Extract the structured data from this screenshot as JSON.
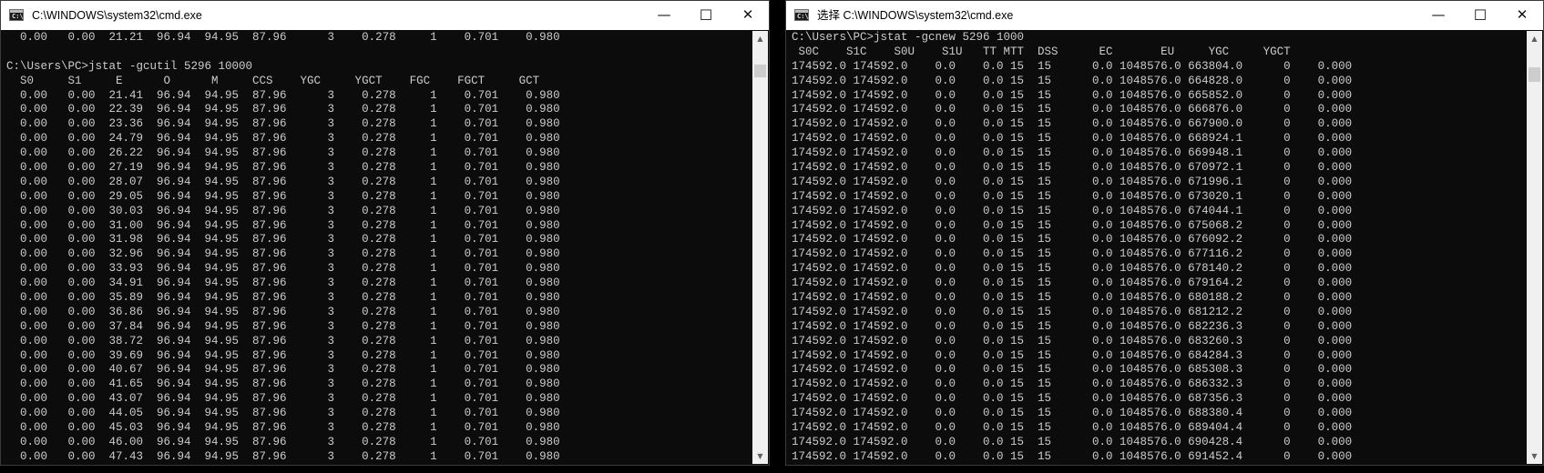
{
  "left_window": {
    "icon_label": "C:\\",
    "title": "C:\\WINDOWS\\system32\\cmd.exe",
    "controls": {
      "minimize": "—",
      "maximize": "☐",
      "close": "✕"
    },
    "lines": [
      "  0.00   0.00  21.21  96.94  94.95  87.96      3    0.278     1    0.701    0.980",
      "",
      "C:\\Users\\PC>jstat -gcutil 5296 10000",
      "  S0     S1     E      O      M     CCS    YGC     YGCT    FGC    FGCT     GCT",
      "  0.00   0.00  21.41  96.94  94.95  87.96      3    0.278     1    0.701    0.980",
      "  0.00   0.00  22.39  96.94  94.95  87.96      3    0.278     1    0.701    0.980",
      "  0.00   0.00  23.36  96.94  94.95  87.96      3    0.278     1    0.701    0.980",
      "  0.00   0.00  24.79  96.94  94.95  87.96      3    0.278     1    0.701    0.980",
      "  0.00   0.00  26.22  96.94  94.95  87.96      3    0.278     1    0.701    0.980",
      "  0.00   0.00  27.19  96.94  94.95  87.96      3    0.278     1    0.701    0.980",
      "  0.00   0.00  28.07  96.94  94.95  87.96      3    0.278     1    0.701    0.980",
      "  0.00   0.00  29.05  96.94  94.95  87.96      3    0.278     1    0.701    0.980",
      "  0.00   0.00  30.03  96.94  94.95  87.96      3    0.278     1    0.701    0.980",
      "  0.00   0.00  31.00  96.94  94.95  87.96      3    0.278     1    0.701    0.980",
      "  0.00   0.00  31.98  96.94  94.95  87.96      3    0.278     1    0.701    0.980",
      "  0.00   0.00  32.96  96.94  94.95  87.96      3    0.278     1    0.701    0.980",
      "  0.00   0.00  33.93  96.94  94.95  87.96      3    0.278     1    0.701    0.980",
      "  0.00   0.00  34.91  96.94  94.95  87.96      3    0.278     1    0.701    0.980",
      "  0.00   0.00  35.89  96.94  94.95  87.96      3    0.278     1    0.701    0.980",
      "  0.00   0.00  36.86  96.94  94.95  87.96      3    0.278     1    0.701    0.980",
      "  0.00   0.00  37.84  96.94  94.95  87.96      3    0.278     1    0.701    0.980",
      "  0.00   0.00  38.72  96.94  94.95  87.96      3    0.278     1    0.701    0.980",
      "  0.00   0.00  39.69  96.94  94.95  87.96      3    0.278     1    0.701    0.980",
      "  0.00   0.00  40.67  96.94  94.95  87.96      3    0.278     1    0.701    0.980",
      "  0.00   0.00  41.65  96.94  94.95  87.96      3    0.278     1    0.701    0.980",
      "  0.00   0.00  43.07  96.94  94.95  87.96      3    0.278     1    0.701    0.980",
      "  0.00   0.00  44.05  96.94  94.95  87.96      3    0.278     1    0.701    0.980",
      "  0.00   0.00  45.03  96.94  94.95  87.96      3    0.278     1    0.701    0.980",
      "  0.00   0.00  46.00  96.94  94.95  87.96      3    0.278     1    0.701    0.980",
      "  0.00   0.00  47.43  96.94  94.95  87.96      3    0.278     1    0.701    0.980"
    ]
  },
  "right_window": {
    "icon_label": "C:\\",
    "title": "选择 C:\\WINDOWS\\system32\\cmd.exe",
    "controls": {
      "minimize": "—",
      "maximize": "☐",
      "close": "✕"
    },
    "lines": [
      "C:\\Users\\PC>jstat -gcnew 5296 1000",
      " S0C    S1C    S0U    S1U   TT MTT  DSS      EC       EU     YGC     YGCT",
      "174592.0 174592.0    0.0    0.0 15  15      0.0 1048576.0 663804.0      0    0.000",
      "174592.0 174592.0    0.0    0.0 15  15      0.0 1048576.0 664828.0      0    0.000",
      "174592.0 174592.0    0.0    0.0 15  15      0.0 1048576.0 665852.0      0    0.000",
      "174592.0 174592.0    0.0    0.0 15  15      0.0 1048576.0 666876.0      0    0.000",
      "174592.0 174592.0    0.0    0.0 15  15      0.0 1048576.0 667900.0      0    0.000",
      "174592.0 174592.0    0.0    0.0 15  15      0.0 1048576.0 668924.1      0    0.000",
      "174592.0 174592.0    0.0    0.0 15  15      0.0 1048576.0 669948.1      0    0.000",
      "174592.0 174592.0    0.0    0.0 15  15      0.0 1048576.0 670972.1      0    0.000",
      "174592.0 174592.0    0.0    0.0 15  15      0.0 1048576.0 671996.1      0    0.000",
      "174592.0 174592.0    0.0    0.0 15  15      0.0 1048576.0 673020.1      0    0.000",
      "174592.0 174592.0    0.0    0.0 15  15      0.0 1048576.0 674044.1      0    0.000",
      "174592.0 174592.0    0.0    0.0 15  15      0.0 1048576.0 675068.2      0    0.000",
      "174592.0 174592.0    0.0    0.0 15  15      0.0 1048576.0 676092.2      0    0.000",
      "174592.0 174592.0    0.0    0.0 15  15      0.0 1048576.0 677116.2      0    0.000",
      "174592.0 174592.0    0.0    0.0 15  15      0.0 1048576.0 678140.2      0    0.000",
      "174592.0 174592.0    0.0    0.0 15  15      0.0 1048576.0 679164.2      0    0.000",
      "174592.0 174592.0    0.0    0.0 15  15      0.0 1048576.0 680188.2      0    0.000",
      "174592.0 174592.0    0.0    0.0 15  15      0.0 1048576.0 681212.2      0    0.000",
      "174592.0 174592.0    0.0    0.0 15  15      0.0 1048576.0 682236.3      0    0.000",
      "174592.0 174592.0    0.0    0.0 15  15      0.0 1048576.0 683260.3      0    0.000",
      "174592.0 174592.0    0.0    0.0 15  15      0.0 1048576.0 684284.3      0    0.000",
      "174592.0 174592.0    0.0    0.0 15  15      0.0 1048576.0 685308.3      0    0.000",
      "174592.0 174592.0    0.0    0.0 15  15      0.0 1048576.0 686332.3      0    0.000",
      "174592.0 174592.0    0.0    0.0 15  15      0.0 1048576.0 687356.3      0    0.000",
      "174592.0 174592.0    0.0    0.0 15  15      0.0 1048576.0 688380.4      0    0.000",
      "174592.0 174592.0    0.0    0.0 15  15      0.0 1048576.0 689404.4      0    0.000",
      "174592.0 174592.0    0.0    0.0 15  15      0.0 1048576.0 690428.4      0    0.000",
      "174592.0 174592.0    0.0    0.0 15  15      0.0 1048576.0 691452.4      0    0.000"
    ]
  },
  "scroll_arrows": {
    "up": "▲",
    "down": "▼"
  },
  "colors": {
    "console_bg": "#0c0c0c",
    "console_text": "#cccccc",
    "titlebar_bg": "#ffffff"
  }
}
